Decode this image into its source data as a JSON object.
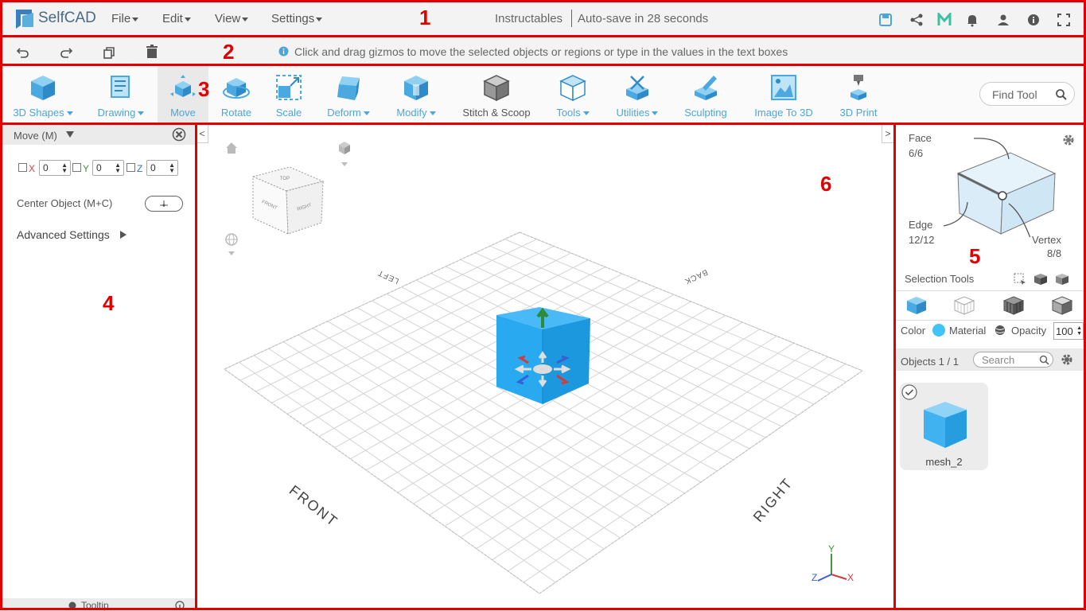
{
  "app": {
    "name": "SelfCAD"
  },
  "menu": {
    "file": "File",
    "edit": "Edit",
    "view": "View",
    "settings": "Settings"
  },
  "header": {
    "project": "Instructables",
    "autosave": "Auto-save in 28 seconds"
  },
  "hint": {
    "text": "Click and drag gizmos to move the selected objects or regions or type in the values in the text boxes"
  },
  "tools": {
    "shapes": "3D Shapes",
    "drawing": "Drawing",
    "move": "Move",
    "rotate": "Rotate",
    "scale": "Scale",
    "deform": "Deform",
    "modify": "Modify",
    "stitch": "Stitch & Scoop",
    "tools": "Tools",
    "utilities": "Utilities",
    "sculpting": "Sculpting",
    "image3d": "Image To 3D",
    "print": "3D Print",
    "find": "Find Tool"
  },
  "left": {
    "title": "Move (M)",
    "x_label": "X",
    "y_label": "Y",
    "z_label": "Z",
    "x_value": "0",
    "y_value": "0",
    "z_value": "0",
    "center": "Center Object (M+C)",
    "advanced": "Advanced Settings",
    "tooltip": "Tooltip"
  },
  "viewport": {
    "labels": {
      "left": "LEFT",
      "back": "BACK",
      "front": "FRONT",
      "right": "RIGHT"
    },
    "cube_faces": {
      "top": "TOP",
      "front": "FRONT",
      "right": "RIGHT"
    },
    "axes": {
      "x": "X",
      "y": "Y",
      "z": "Z"
    }
  },
  "right": {
    "face_label": "Face",
    "face_count": "6/6",
    "edge_label": "Edge",
    "edge_count": "12/12",
    "vertex_label": "Vertex",
    "vertex_count": "8/8",
    "selection_tools": "Selection Tools",
    "color": "Color",
    "material": "Material",
    "opacity": "Opacity",
    "opacity_value": "100",
    "objects": "Objects 1 / 1",
    "search_placeholder": "Search",
    "object_name": "mesh_2"
  },
  "annotations": [
    "1",
    "2",
    "3",
    "4",
    "5",
    "6"
  ],
  "colors": {
    "accent": "#4da6d9",
    "cube": "#29a9f0",
    "annotation": "#e00000"
  }
}
